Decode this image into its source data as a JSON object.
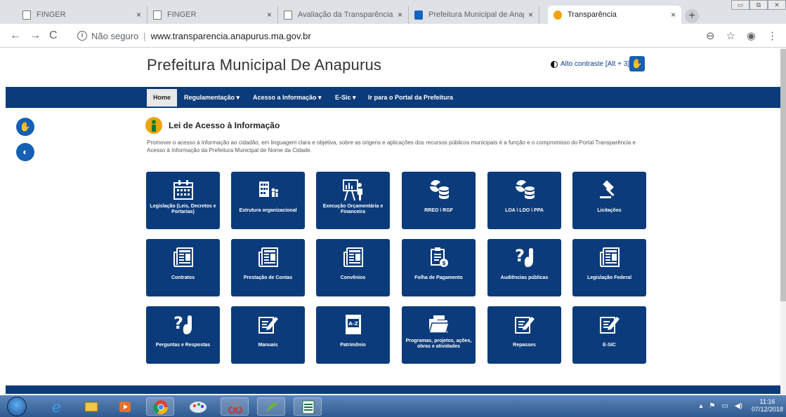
{
  "browser": {
    "tabs": [
      {
        "label": "FINGER",
        "active": false
      },
      {
        "label": "FINGER",
        "active": false
      },
      {
        "label": "Avaliação da Transparência do",
        "active": false
      },
      {
        "label": "Prefeitura Municipal de Anapu",
        "active": false
      },
      {
        "label": "Transparência",
        "active": true
      }
    ],
    "close_glyph": "×",
    "new_tab_glyph": "+",
    "security_label": "Não seguro",
    "url": "www.transparencia.anapurus.ma.gov.br"
  },
  "header": {
    "title": "Prefeitura Municipal De Anapurus",
    "contrast_label": "Alto contraste [Alt + 3]"
  },
  "nav": {
    "items": [
      {
        "label": "Home"
      },
      {
        "label": "Regulamentação ▾"
      },
      {
        "label": "Acesso a Informação ▾"
      },
      {
        "label": "E-Sic ▾"
      },
      {
        "label": "Ir para o Portal da Prefeitura"
      }
    ]
  },
  "section": {
    "title": "Lei de Acesso à Informação",
    "intro": "Promover o acesso à informação ao cidadão, em linguagem clara e objetiva, sobre as origens e aplicações dos recursos públicos municipais é a função e o compromisso do Portal Transparência e Acesso à Informação da Prefeitura Municipal de Nome da Cidade."
  },
  "tiles": [
    {
      "label": "Legislação (Leis, Decretos e Portarias)",
      "icon": "calendar-icon"
    },
    {
      "label": "Estrutura organizacional",
      "icon": "organization-icon"
    },
    {
      "label": "Execução Orçamentária e Financeira",
      "icon": "presentation-icon"
    },
    {
      "label": "RREO \\ RGF",
      "icon": "database-chart-icon"
    },
    {
      "label": "LOA \\ LDO \\ PPA",
      "icon": "database-chart-icon"
    },
    {
      "label": "Licitações",
      "icon": "gavel-icon"
    },
    {
      "label": "Contratos",
      "icon": "newspaper-icon"
    },
    {
      "label": "Prestação de Contas",
      "icon": "newspaper-icon"
    },
    {
      "label": "Convênios",
      "icon": "newspaper-icon"
    },
    {
      "label": "Folha de Pagamento",
      "icon": "payroll-icon"
    },
    {
      "label": "Audiências públicas",
      "icon": "question-hand-icon"
    },
    {
      "label": "Legislação Federal",
      "icon": "newspaper-icon"
    },
    {
      "label": "Perguntas e Respostas",
      "icon": "question-hand-icon"
    },
    {
      "label": "Manuais",
      "icon": "edit-icon"
    },
    {
      "label": "Patrimônio",
      "icon": "az-book-icon"
    },
    {
      "label": "Programas, projetos, ações, obras e atividades",
      "icon": "folder-icon"
    },
    {
      "label": "Repasses",
      "icon": "edit-icon"
    },
    {
      "label": "E-SIC",
      "icon": "edit-icon"
    }
  ],
  "taskbar": {
    "time": "11:16",
    "date": "07/12/2018"
  },
  "colors": {
    "brand_blue": "#0b3b7a",
    "accent_blue": "#1460b3",
    "info_orange": "#f0a30a"
  }
}
